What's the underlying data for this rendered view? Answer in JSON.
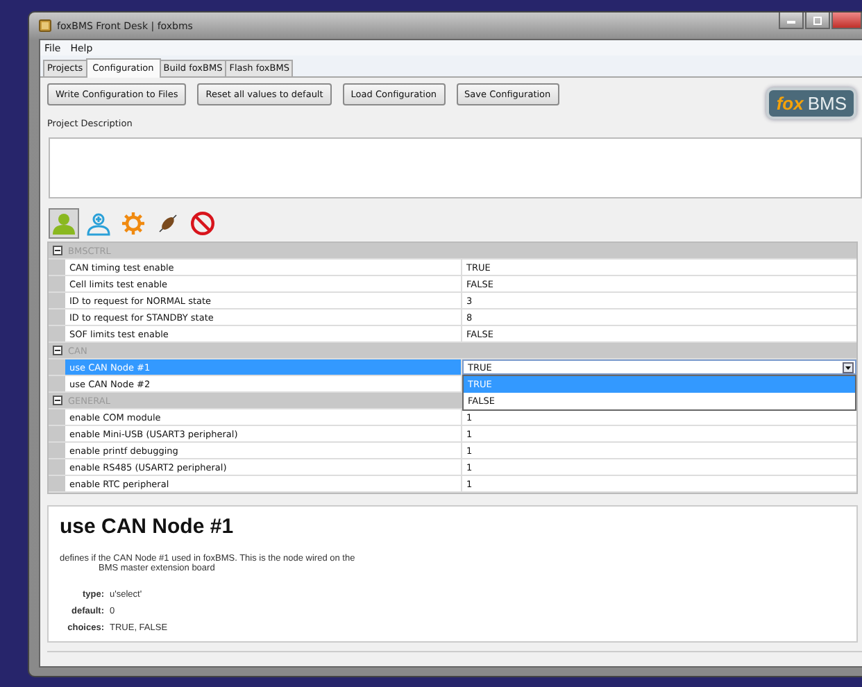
{
  "window": {
    "title": "foxBMS Front Desk | foxbms"
  },
  "menu": [
    "File",
    "Help"
  ],
  "tabs": [
    {
      "label": "Projects",
      "selected": false
    },
    {
      "label": "Configuration",
      "selected": true
    },
    {
      "label": "Build foxBMS",
      "selected": false
    },
    {
      "label": "Flash foxBMS",
      "selected": false
    }
  ],
  "buttons": [
    "Write Configuration to Files",
    "Reset all values to default",
    "Load Configuration",
    "Save Configuration"
  ],
  "logo": {
    "part_1": "fox",
    "part_2": "BMS"
  },
  "project_description": {
    "label": "Project Description"
  },
  "toolbar": [
    {
      "kind": "user",
      "selected": true
    },
    {
      "kind": "user-add",
      "selected": false
    },
    {
      "kind": "gear",
      "selected": false
    },
    {
      "kind": "bug",
      "selected": false
    },
    {
      "kind": "forbidden",
      "selected": false
    }
  ],
  "groups": [
    {
      "name": "BMSCTRL",
      "expanded": true,
      "rows": [
        {
          "name": "CAN timing test enable",
          "value": "TRUE",
          "selected": false
        },
        {
          "name": "Cell limits test enable",
          "value": "FALSE",
          "selected": false
        },
        {
          "name": "ID to request for NORMAL state",
          "value": "3",
          "selected": false
        },
        {
          "name": "ID to request for STANDBY state",
          "value": "8",
          "selected": false
        },
        {
          "name": "SOF limits test enable",
          "value": "FALSE",
          "selected": false
        }
      ]
    },
    {
      "name": "CAN",
      "expanded": true,
      "rows": [
        {
          "name": "use CAN Node #1",
          "value": "TRUE",
          "selected": true,
          "dropdown": [
            {
              "label": "TRUE",
              "selected": true
            },
            {
              "label": "FALSE",
              "selected": false
            }
          ]
        },
        {
          "name": "use CAN Node #2",
          "value": "",
          "selected": false
        }
      ]
    },
    {
      "name": "GENERAL",
      "expanded": true,
      "rows": [
        {
          "name": "enable COM module",
          "value": "1",
          "selected": false
        },
        {
          "name": "enable Mini-USB (USART3 peripheral)",
          "value": "1",
          "selected": false
        },
        {
          "name": "enable printf debugging",
          "value": "1",
          "selected": false
        },
        {
          "name": "enable RS485 (USART2 peripheral)",
          "value": "1",
          "selected": false
        },
        {
          "name": "enable RTC peripheral",
          "value": "1",
          "selected": false
        }
      ]
    }
  ],
  "details": {
    "title": "use CAN Node #1",
    "description": [
      "defines if the CAN Node #1 used in foxBMS. This is the node wired on the",
      "BMS master extension board"
    ],
    "fields": [
      {
        "label": "type:",
        "value": "u'select'"
      },
      {
        "label": "default:",
        "value": "0"
      },
      {
        "label": "choices:",
        "value": "TRUE, FALSE"
      }
    ]
  }
}
